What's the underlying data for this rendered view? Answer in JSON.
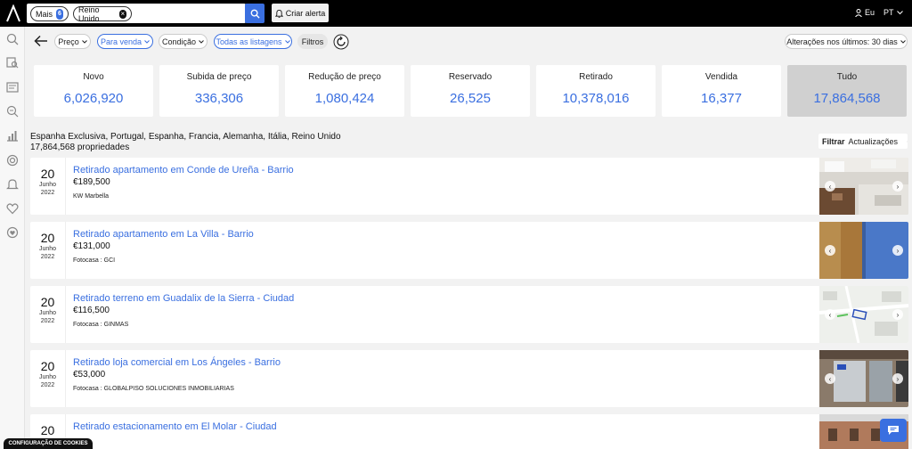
{
  "topbar": {
    "chip_mais": {
      "label": "Mais",
      "count": "6"
    },
    "chip_location": "Reino Unido",
    "alert_label": "Criar alerta",
    "user_label": "Eu",
    "lang_label": "PT"
  },
  "filters": {
    "price": "Preço",
    "for_sale": "Para venda",
    "condition": "Condição",
    "listings": "Todas as listagens",
    "filters": "Filtros",
    "changes": "Alterações nos últimos: 30 dias"
  },
  "stats": [
    {
      "label": "Novo",
      "value": "6,026,920"
    },
    {
      "label": "Subida de preço",
      "value": "336,306"
    },
    {
      "label": "Redução de preço",
      "value": "1,080,424"
    },
    {
      "label": "Reservado",
      "value": "26,525"
    },
    {
      "label": "Retirado",
      "value": "10,378,016"
    },
    {
      "label": "Vendida",
      "value": "16,377"
    },
    {
      "label": "Tudo",
      "value": "17,864,568"
    }
  ],
  "results": {
    "locations": "Espanha Exclusiva, Portugal, Espanha, Francia, Alemanha, Itália, Reino Unido",
    "count": "17,864,568 propriedades",
    "filter_label": "Filtrar",
    "sort_label": "Actualizações"
  },
  "listings": [
    {
      "day": "20",
      "month": "Junho",
      "year": "2022",
      "title": "Retirado apartamento em Conde de Ureña - Barrio",
      "price": "€189,500",
      "agent": "KW Marbella"
    },
    {
      "day": "20",
      "month": "Junho",
      "year": "2022",
      "title": "Retirado apartamento em La Villa - Barrio",
      "price": "€131,000",
      "agent": "Fotocasa : GCI"
    },
    {
      "day": "20",
      "month": "Junho",
      "year": "2022",
      "title": "Retirado terreno em Guadalix de la Sierra - Ciudad",
      "price": "€116,500",
      "agent": "Fotocasa : GINMAS"
    },
    {
      "day": "20",
      "month": "Junho",
      "year": "2022",
      "title": "Retirado loja comercial em Los Ángeles - Barrio",
      "price": "€53,000",
      "agent": "Fotocasa : GLOBALPISO SOLUCIONES INMOBILIARIAS"
    },
    {
      "day": "20",
      "month": "",
      "year": "",
      "title": "Retirado estacionamento em El Molar - Ciudad",
      "price": "",
      "agent": ""
    }
  ],
  "cookies_label": "CONFIGURAÇÃO DE COOKIES",
  "colors": {
    "accent": "#3a6fe0",
    "topbar": "#000000",
    "selected_card": "#d0d0d0"
  }
}
